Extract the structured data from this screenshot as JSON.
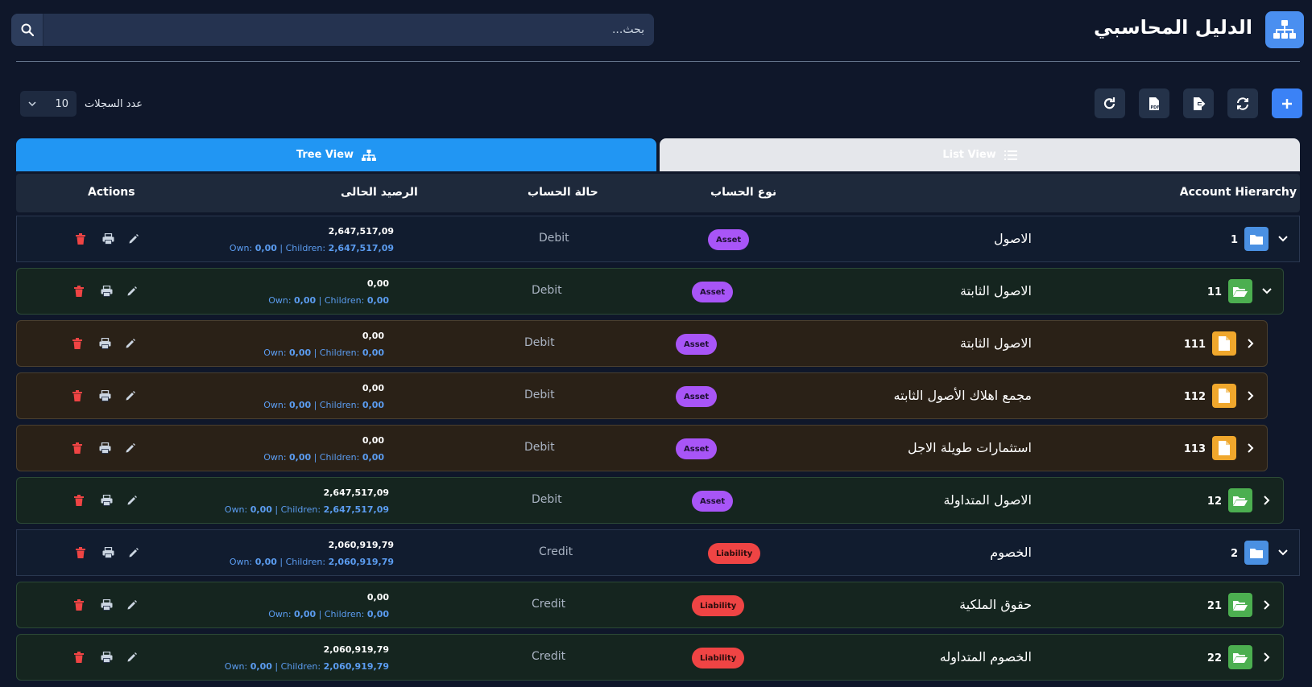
{
  "header": {
    "title": "الدليل المحاسبي",
    "search_placeholder": "بحث..."
  },
  "records": {
    "label": "عدد السجلات",
    "value": "10"
  },
  "tabs": {
    "tree": "Tree View",
    "list": "List View"
  },
  "columns": {
    "hierarchy": "Account Hierarchy",
    "type": "نوع الحساب",
    "status": "حالة الحساب",
    "balance": "الرصيد الحالى",
    "actions": "Actions"
  },
  "labels": {
    "own": "Own:",
    "children": "Children:"
  },
  "rows": [
    {
      "code": "1",
      "name": "الاصول",
      "type": "Asset",
      "status": "Debit",
      "balance": "2,647,517,09",
      "own": "0,00",
      "children": "2,647,517,09"
    },
    {
      "code": "11",
      "name": "الاصول الثابتة",
      "type": "Asset",
      "status": "Debit",
      "balance": "0,00",
      "own": "0,00",
      "children": "0,00"
    },
    {
      "code": "111",
      "name": "الاصول الثابتة",
      "type": "Asset",
      "status": "Debit",
      "balance": "0,00",
      "own": "0,00",
      "children": "0,00"
    },
    {
      "code": "112",
      "name": "مجمع اهلاك الأصول الثابته",
      "type": "Asset",
      "status": "Debit",
      "balance": "0,00",
      "own": "0,00",
      "children": "0,00"
    },
    {
      "code": "113",
      "name": "استثمارات طويلة الاجل",
      "type": "Asset",
      "status": "Debit",
      "balance": "0,00",
      "own": "0,00",
      "children": "0,00"
    },
    {
      "code": "12",
      "name": "الاصول المتداولة",
      "type": "Asset",
      "status": "Debit",
      "balance": "2,647,517,09",
      "own": "0,00",
      "children": "2,647,517,09"
    },
    {
      "code": "2",
      "name": "الخصوم",
      "type": "Liability",
      "status": "Credit",
      "balance": "2,060,919,79",
      "own": "0,00",
      "children": "2,060,919,79"
    },
    {
      "code": "21",
      "name": "حقوق الملكية",
      "type": "Liability",
      "status": "Credit",
      "balance": "0,00",
      "own": "0,00",
      "children": "0,00"
    },
    {
      "code": "22",
      "name": "الخصوم المتداوله",
      "type": "Liability",
      "status": "Credit",
      "balance": "2,060,919,79",
      "own": "0,00",
      "children": "2,060,919,79"
    }
  ]
}
